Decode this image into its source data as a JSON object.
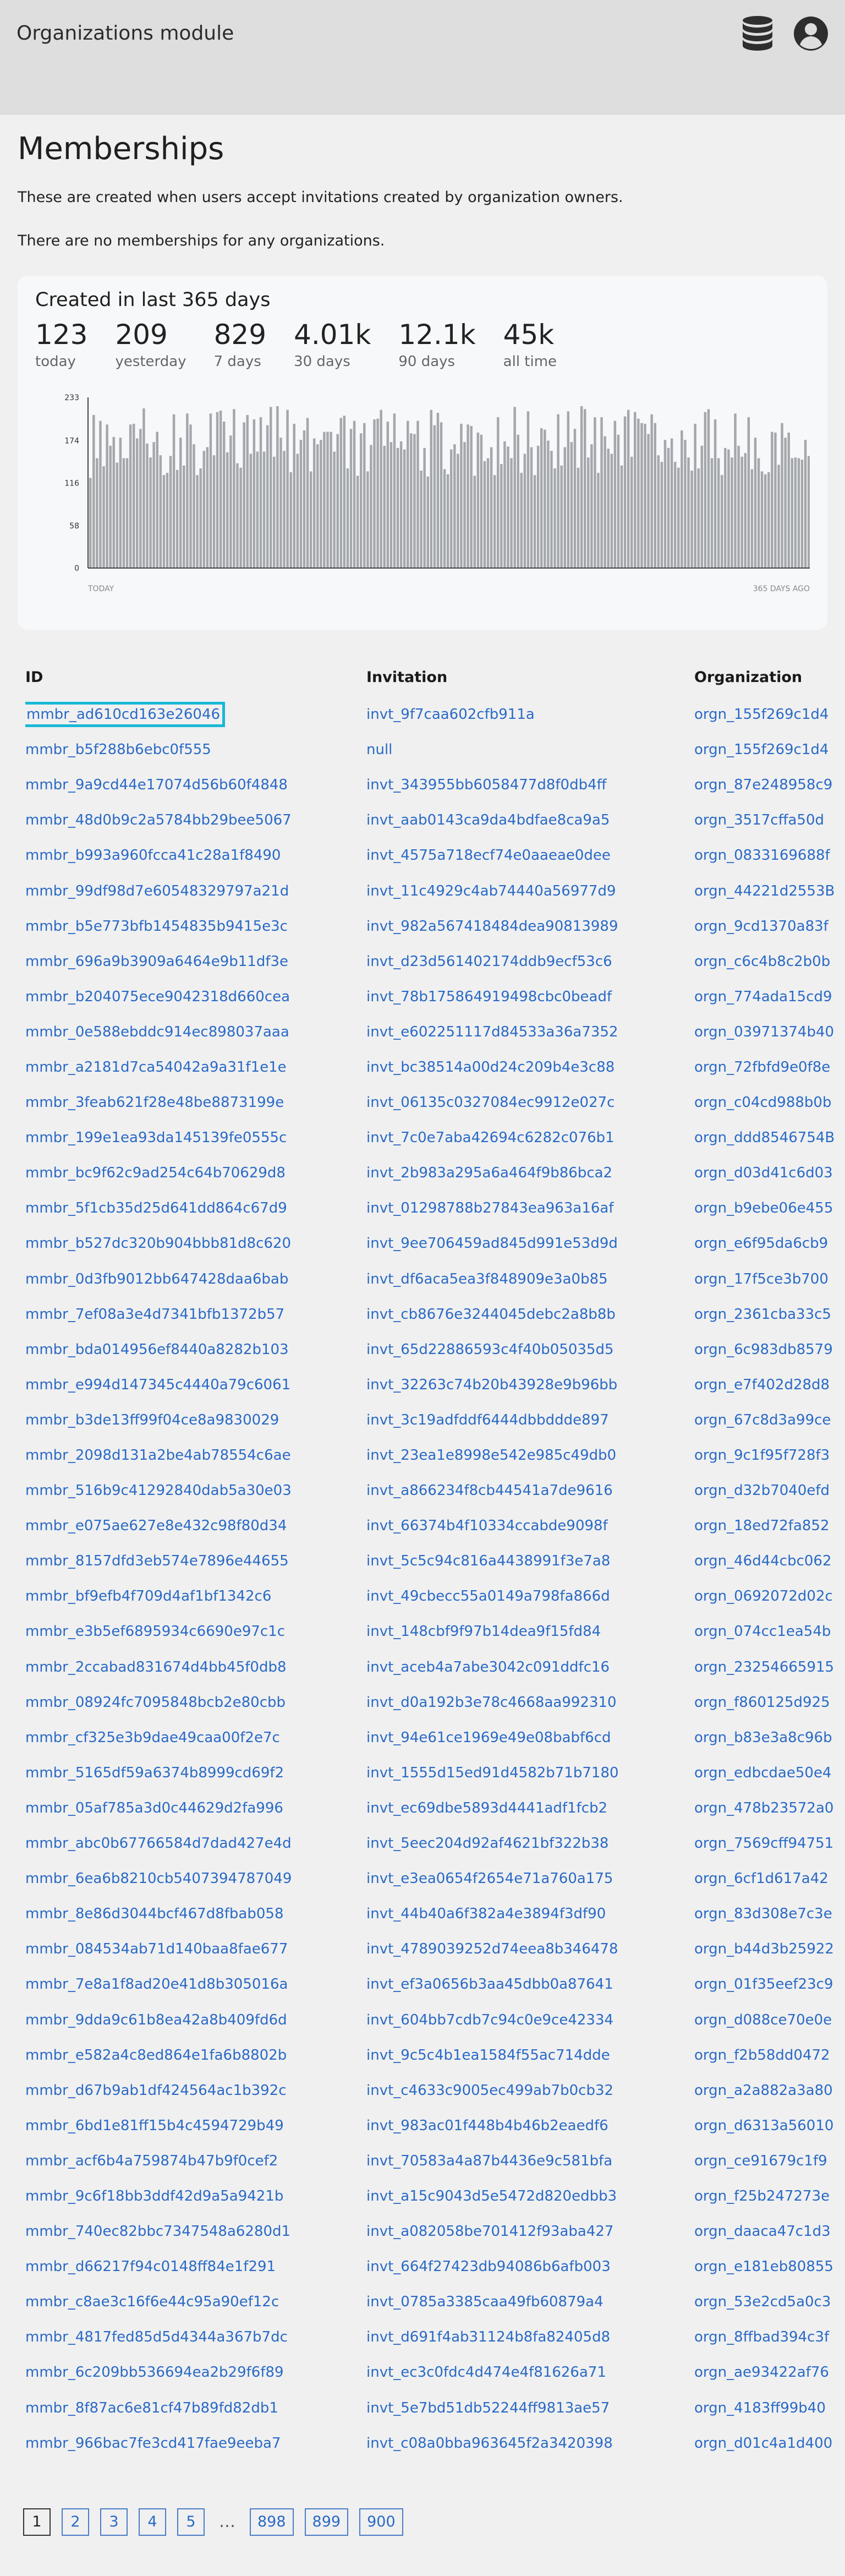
{
  "app": {
    "title": "Organizations module",
    "icons": [
      "database-icon",
      "user-account-icon"
    ]
  },
  "page": {
    "title": "Memberships",
    "description": "These are created when users accept invitations created by organization owners.",
    "empty_note": "There are no memberships for any organizations."
  },
  "summary": {
    "title": "Created in last 365 days",
    "stats": [
      {
        "value": "123",
        "label": "today"
      },
      {
        "value": "209",
        "label": "yesterday"
      },
      {
        "value": "829",
        "label": "7 days"
      },
      {
        "value": "4.01k",
        "label": "30 days"
      },
      {
        "value": "12.1k",
        "label": "90 days"
      },
      {
        "value": "45k",
        "label": "all time"
      }
    ]
  },
  "chart_data": {
    "type": "bar",
    "title": "",
    "x_start_label": "TODAY",
    "x_end_label": "365 DAYS AGO",
    "y_ticks": [
      "233",
      "174",
      "116",
      "58",
      "0"
    ],
    "ylim": [
      0,
      233
    ],
    "bar_count": 216,
    "bar_color": "#a4a7ab",
    "grid": false,
    "values": [
      123,
      209,
      150,
      201,
      139,
      196,
      167,
      179,
      144,
      178,
      150,
      150,
      196,
      197,
      177,
      190,
      218,
      170,
      151,
      172,
      186,
      154,
      127,
      130,
      153,
      210,
      134,
      178,
      140,
      211,
      196,
      169,
      127,
      136,
      160,
      165,
      211,
      154,
      213,
      215,
      200,
      158,
      181,
      217,
      143,
      137,
      199,
      209,
      156,
      203,
      159,
      206,
      159,
      195,
      220,
      152,
      221,
      178,
      160,
      216,
      131,
      197,
      156,
      175,
      188,
      205,
      132,
      177,
      169,
      175,
      186,
      186,
      186,
      159,
      183,
      205,
      208,
      136,
      190,
      201,
      126,
      184,
      198,
      132,
      168,
      203,
      204,
      216,
      167,
      200,
      172,
      211,
      164,
      173,
      162,
      201,
      184,
      183,
      201,
      133,
      164,
      125,
      216,
      195,
      212,
      199,
      135,
      128,
      162,
      169,
      156,
      197,
      172,
      196,
      194,
      126,
      185,
      182,
      146,
      150,
      165,
      127,
      206,
      142,
      173,
      166,
      150,
      220,
      182,
      130,
      156,
      214,
      165,
      127,
      167,
      191,
      189,
      174,
      160,
      136,
      210,
      140,
      165,
      214,
      172,
      190,
      137,
      221,
      217,
      151,
      169,
      206,
      130,
      206,
      180,
      163,
      156,
      201,
      182,
      140,
      207,
      216,
      152,
      213,
      204,
      198,
      197,
      183,
      210,
      198,
      154,
      145,
      175,
      164,
      177,
      145,
      137,
      188,
      175,
      151,
      133,
      197,
      136,
      167,
      213,
      217,
      150,
      203,
      150,
      127,
      164,
      162,
      151,
      211,
      167,
      152,
      157,
      206,
      135,
      178,
      150,
      132,
      128,
      131,
      186,
      185,
      141,
      198,
      178,
      185,
      150,
      151,
      150,
      148,
      175,
      153
    ]
  },
  "table": {
    "columns": [
      "ID",
      "Invitation",
      "Organization"
    ],
    "selected_row": 0,
    "rows": [
      [
        "mmbr_ad610cd163e26046",
        "invt_9f7caa602cfb911a",
        "orgn_155f269c1d4"
      ],
      [
        "mmbr_b5f288b6ebc0f555",
        "null",
        "orgn_155f269c1d4"
      ],
      [
        "mmbr_9a9cd44e17074d56b60f4848",
        "invt_343955bb6058477d8f0db4ff",
        "orgn_87e248958c9"
      ],
      [
        "mmbr_48d0b9c2a5784bb29bee5067",
        "invt_aab0143ca9da4bdfae8ca9a5",
        "orgn_3517cffa50d"
      ],
      [
        "mmbr_b993a960fcca41c28a1f8490",
        "invt_4575a718ecf74e0aaeae0dee",
        "orgn_0833169688f"
      ],
      [
        "mmbr_99df98d7e60548329797a21d",
        "invt_11c4929c4ab74440a56977d9",
        "orgn_44221d2553B"
      ],
      [
        "mmbr_b5e773bfb1454835b9415e3c",
        "invt_982a567418484dea90813989",
        "orgn_9cd1370a83f"
      ],
      [
        "mmbr_696a9b3909a6464e9b11df3e",
        "invt_d23d561402174ddb9ecf53c6",
        "orgn_c6c4b8c2b0b"
      ],
      [
        "mmbr_b204075ece9042318d660cea",
        "invt_78b175864919498cbc0beadf",
        "orgn_774ada15cd9"
      ],
      [
        "mmbr_0e588ebddc914ec898037aaa",
        "invt_e602251117d84533a36a7352",
        "orgn_03971374b40"
      ],
      [
        "mmbr_a2181d7ca54042a9a31f1e1e",
        "invt_bc38514a00d24c209b4e3c88",
        "orgn_72fbfd9e0f8e"
      ],
      [
        "mmbr_3feab621f28e48be8873199e",
        "invt_06135c0327084ec9912e027c",
        "orgn_c04cd988b0b"
      ],
      [
        "mmbr_199e1ea93da145139fe0555c",
        "invt_7c0e7aba42694c6282c076b1",
        "orgn_ddd8546754B"
      ],
      [
        "mmbr_bc9f62c9ad254c64b70629d8",
        "invt_2b983a295a6a464f9b86bca2",
        "orgn_d03d41c6d03"
      ],
      [
        "mmbr_5f1cb35d25d641dd864c67d9",
        "invt_01298788b27843ea963a16af",
        "orgn_b9ebe06e455"
      ],
      [
        "mmbr_b527dc320b904bbb81d8c620",
        "invt_9ee706459ad845d991e53d9d",
        "orgn_e6f95da6cb9"
      ],
      [
        "mmbr_0d3fb9012bb647428daa6bab",
        "invt_df6aca5ea3f848909e3a0b85",
        "orgn_17f5ce3b700"
      ],
      [
        "mmbr_7ef08a3e4d7341bfb1372b57",
        "invt_cb8676e3244045debc2a8b8b",
        "orgn_2361cba33c5"
      ],
      [
        "mmbr_bda014956ef8440a8282b103",
        "invt_65d22886593c4f40b05035d5",
        "orgn_6c983db8579"
      ],
      [
        "mmbr_e994d147345c4440a79c6061",
        "invt_32263c74b20b43928e9b96bb",
        "orgn_e7f402d28d8"
      ],
      [
        "mmbr_b3de13ff99f04ce8a9830029",
        "invt_3c19adfddf6444dbbddde897",
        "orgn_67c8d3a99ce"
      ],
      [
        "mmbr_2098d131a2be4ab78554c6ae",
        "invt_23ea1e8998e542e985c49db0",
        "orgn_9c1f95f728f3"
      ],
      [
        "mmbr_516b9c41292840dab5a30e03",
        "invt_a866234f8cb44541a7de9616",
        "orgn_d32b7040efd"
      ],
      [
        "mmbr_e075ae627e8e432c98f80d34",
        "invt_66374b4f10334ccabde9098f",
        "orgn_18ed72fa852"
      ],
      [
        "mmbr_8157dfd3eb574e7896e44655",
        "invt_5c5c94c816a4438991f3e7a8",
        "orgn_46d44cbc062"
      ],
      [
        "mmbr_bf9efb4f709d4af1bf1342c6",
        "invt_49cbecc55a0149a798fa866d",
        "orgn_0692072d02c"
      ],
      [
        "mmbr_e3b5ef6895934c6690e97c1c",
        "invt_148cbf9f97b14dea9f15fd84",
        "orgn_074cc1ea54b"
      ],
      [
        "mmbr_2ccabad831674d4bb45f0db8",
        "invt_aceb4a7abe3042c091ddfc16",
        "orgn_23254665915"
      ],
      [
        "mmbr_08924fc7095848bcb2e80cbb",
        "invt_d0a192b3e78c4668aa992310",
        "orgn_f860125d925"
      ],
      [
        "mmbr_cf325e3b9dae49caa00f2e7c",
        "invt_94e61ce1969e49e08babf6cd",
        "orgn_b83e3a8c96b"
      ],
      [
        "mmbr_5165df59a6374b8999cd69f2",
        "invt_1555d15ed91d4582b71b7180",
        "orgn_edbcdae50e4"
      ],
      [
        "mmbr_05af785a3d0c44629d2fa996",
        "invt_ec69dbe5893d4441adf1fcb2",
        "orgn_478b23572a0"
      ],
      [
        "mmbr_abc0b67766584d7dad427e4d",
        "invt_5eec204d92af4621bf322b38",
        "orgn_7569cff94751"
      ],
      [
        "mmbr_6ea6b8210cb5407394787049",
        "invt_e3ea0654f2654e71a760a175",
        "orgn_6cf1d617a42"
      ],
      [
        "mmbr_8e86d3044bcf467d8fbab058",
        "invt_44b40a6f382a4e3894f3df90",
        "orgn_83d308e7c3e"
      ],
      [
        "mmbr_084534ab71d140baa8fae677",
        "invt_4789039252d74eea8b346478",
        "orgn_b44d3b25922"
      ],
      [
        "mmbr_7e8a1f8ad20e41d8b305016a",
        "invt_ef3a0656b3aa45dbb0a87641",
        "orgn_01f35eef23c9"
      ],
      [
        "mmbr_9dda9c61b8ea42a8b409fd6d",
        "invt_604bb7cdb7c94c0e9ce42334",
        "orgn_d088ce70e0e"
      ],
      [
        "mmbr_e582a4c8ed864e1fa6b8802b",
        "invt_9c5c4b1ea1584f55ac714dde",
        "orgn_f2b58dd0472"
      ],
      [
        "mmbr_d67b9ab1df424564ac1b392c",
        "invt_c4633c9005ec499ab7b0cb32",
        "orgn_a2a882a3a80"
      ],
      [
        "mmbr_6bd1e81ff15b4c4594729b49",
        "invt_983ac01f448b4b46b2eaedf6",
        "orgn_d6313a56010"
      ],
      [
        "mmbr_acf6b4a759874b47b9f0cef2",
        "invt_70583a4a87b4436e9c581bfa",
        "orgn_ce91679c1f9"
      ],
      [
        "mmbr_9c6f18bb3ddf42d9a5a9421b",
        "invt_a15c9043d5e5472d820edbb3",
        "orgn_f25b247273e"
      ],
      [
        "mmbr_740ec82bbc7347548a6280d1",
        "invt_a082058be701412f93aba427",
        "orgn_daaca47c1d3"
      ],
      [
        "mmbr_d66217f94c0148ff84e1f291",
        "invt_664f27423db94086b6afb003",
        "orgn_e181eb80855"
      ],
      [
        "mmbr_c8ae3c16f6e44c95a90ef12c",
        "invt_0785a3385caa49fb60879a4",
        "orgn_53e2cd5a0c3"
      ],
      [
        "mmbr_4817fed85d5d4344a367b7dc",
        "invt_d691f4ab31124b8fa82405d8",
        "orgn_8ffbad394c3f"
      ],
      [
        "mmbr_6c209bb536694ea2b29f6f89",
        "invt_ec3c0fdc4d474e4f81626a71",
        "orgn_ae93422af76"
      ],
      [
        "mmbr_8f87ac6e81cf47b89fd82db1",
        "invt_5e7bd51db52244ff9813ae57",
        "orgn_4183ff99b40"
      ],
      [
        "mmbr_966bac7fe3cd417fae9eeba7",
        "invt_c08a0bba963645f2a3420398",
        "orgn_d01c4a1d400"
      ]
    ]
  },
  "pagination": {
    "pages": [
      "1",
      "2",
      "3",
      "4",
      "5"
    ],
    "ellipsis": "…",
    "last_pages": [
      "898",
      "899",
      "900"
    ],
    "current": "1"
  }
}
